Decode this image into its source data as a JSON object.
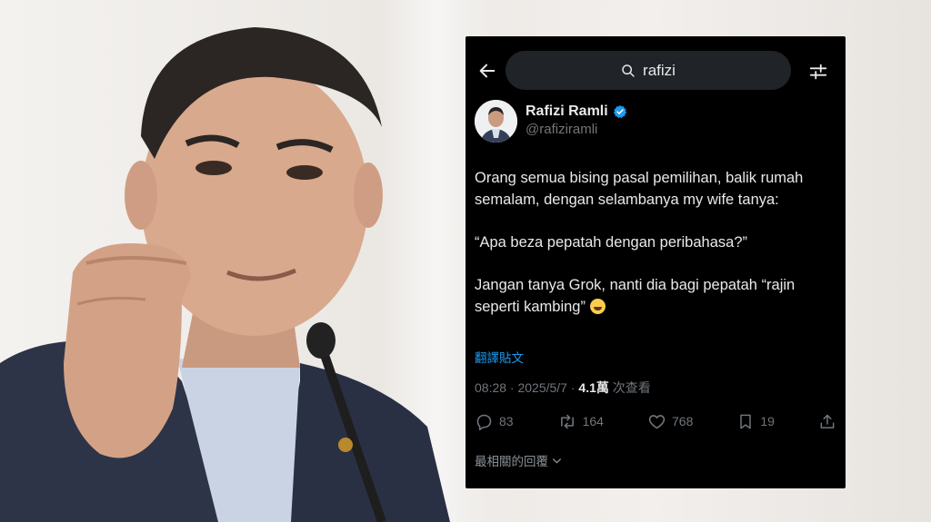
{
  "search": {
    "query": "rafizi"
  },
  "user": {
    "display_name": "Rafizi Ramli",
    "handle": "@rafiziramli"
  },
  "tweet": {
    "paragraphs": [
      "Orang semua bising pasal pemilihan, balik rumah semalam, dengan selambanya my wife tanya:",
      "“Apa beza pepatah dengan peribahasa?”",
      "Jangan tanya Grok, nanti dia bagi pepatah “rajin seperti kambing”"
    ],
    "translate_label": "翻譯貼文",
    "timestamp": "08:28 · 2025/5/7 · ",
    "views_count": "4.1萬",
    "views_label": " 次查看"
  },
  "actions": {
    "replies": "83",
    "reposts": "164",
    "likes": "768",
    "bookmarks": "19"
  },
  "sort": {
    "label": "最相關的回覆"
  },
  "icons": [
    "back-arrow-icon",
    "search-icon",
    "filter-icon",
    "verified-badge-icon",
    "reply-icon",
    "repost-icon",
    "like-icon",
    "bookmark-icon",
    "share-icon",
    "chevron-down-icon",
    "laughing-emoji-icon"
  ],
  "colors": {
    "background": "#000000",
    "text": "#e7e9ea",
    "muted": "#71767b",
    "link": "#1d9bf0",
    "search_pill": "#202327"
  }
}
